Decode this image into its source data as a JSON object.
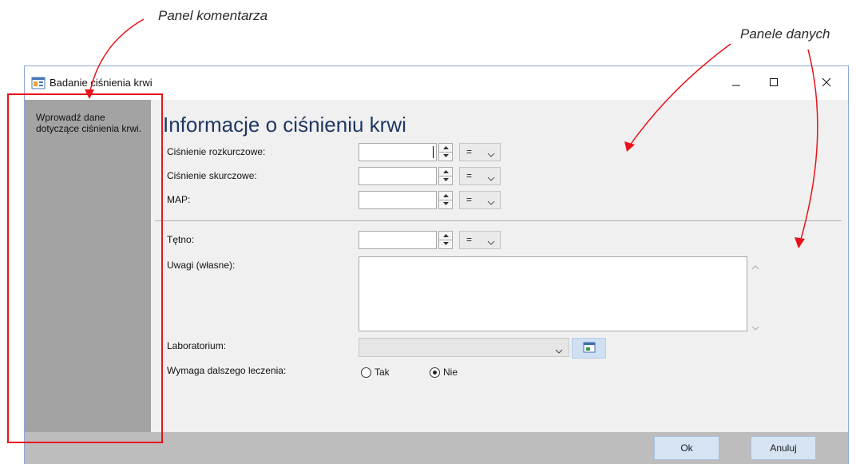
{
  "annotations": {
    "comment_panel": "Panel komentarza",
    "data_panels": "Panele danych"
  },
  "window": {
    "title": "Badanie ciśnienia krwi",
    "icon": "app-form-icon",
    "controls": [
      "minimize-icon",
      "maximize-icon",
      "close-icon"
    ]
  },
  "sidebar": {
    "text": "Wprowadź dane dotyczące ciśnienia krwi."
  },
  "main": {
    "title": "Informacje o ciśnieniu krwi",
    "fields": [
      {
        "label": "Ciśnienie rozkurczowe:",
        "value": "",
        "operator": "="
      },
      {
        "label": "Ciśnienie skurczowe:",
        "value": "",
        "operator": "="
      },
      {
        "label": "MAP:",
        "value": "",
        "operator": "="
      },
      {
        "label": "Tętno:",
        "value": "",
        "operator": "="
      }
    ],
    "notes_label": "Uwagi (własne):",
    "notes_value": "",
    "lab_label": "Laboratorium:",
    "lab_value": "",
    "followup_label": "Wymaga dalszego leczenia:",
    "followup_options": [
      {
        "label": "Tak",
        "selected": false
      },
      {
        "label": "Nie",
        "selected": true
      }
    ]
  },
  "footer": {
    "ok_label": "Ok",
    "cancel_label": "Anuluj"
  },
  "colors": {
    "annotation_red": "#e8131a",
    "title_blue": "#1f3864",
    "sidebar_gray": "#a3a3a3",
    "footer_gray": "#bdbdbd",
    "button_blue": "#d5e3f2"
  }
}
